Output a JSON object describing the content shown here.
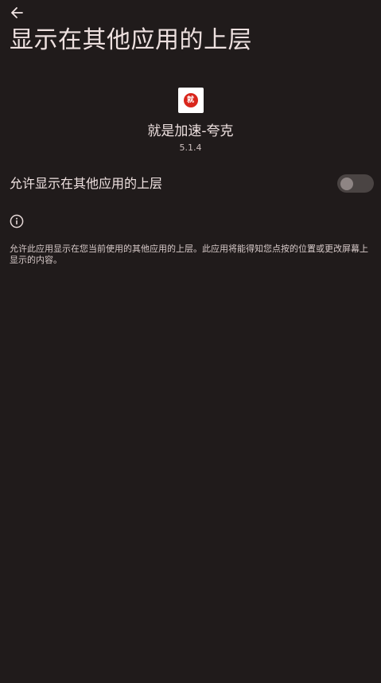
{
  "header": {
    "back_icon": "arrow-back-icon",
    "title": "显示在其他应用的上层"
  },
  "app": {
    "icon": "app-logo-icon",
    "icon_glyph": "就",
    "name": "就是加速-夸克",
    "version": "5.1.4"
  },
  "setting": {
    "label": "允许显示在其他应用的上层",
    "enabled": false
  },
  "info": {
    "icon": "info-icon",
    "description": "允许此应用显示在您当前使用的其他应用的上层。此应用将能得知您点按的位置或更改屏幕上显示的内容。"
  },
  "colors": {
    "background": "#201b1b",
    "text_primary": "#efe2e1",
    "text_secondary": "#cdbfbe",
    "switch_track_off": "#4a4443",
    "switch_thumb_off": "#8e8584",
    "app_icon_accent": "#d9261c"
  }
}
